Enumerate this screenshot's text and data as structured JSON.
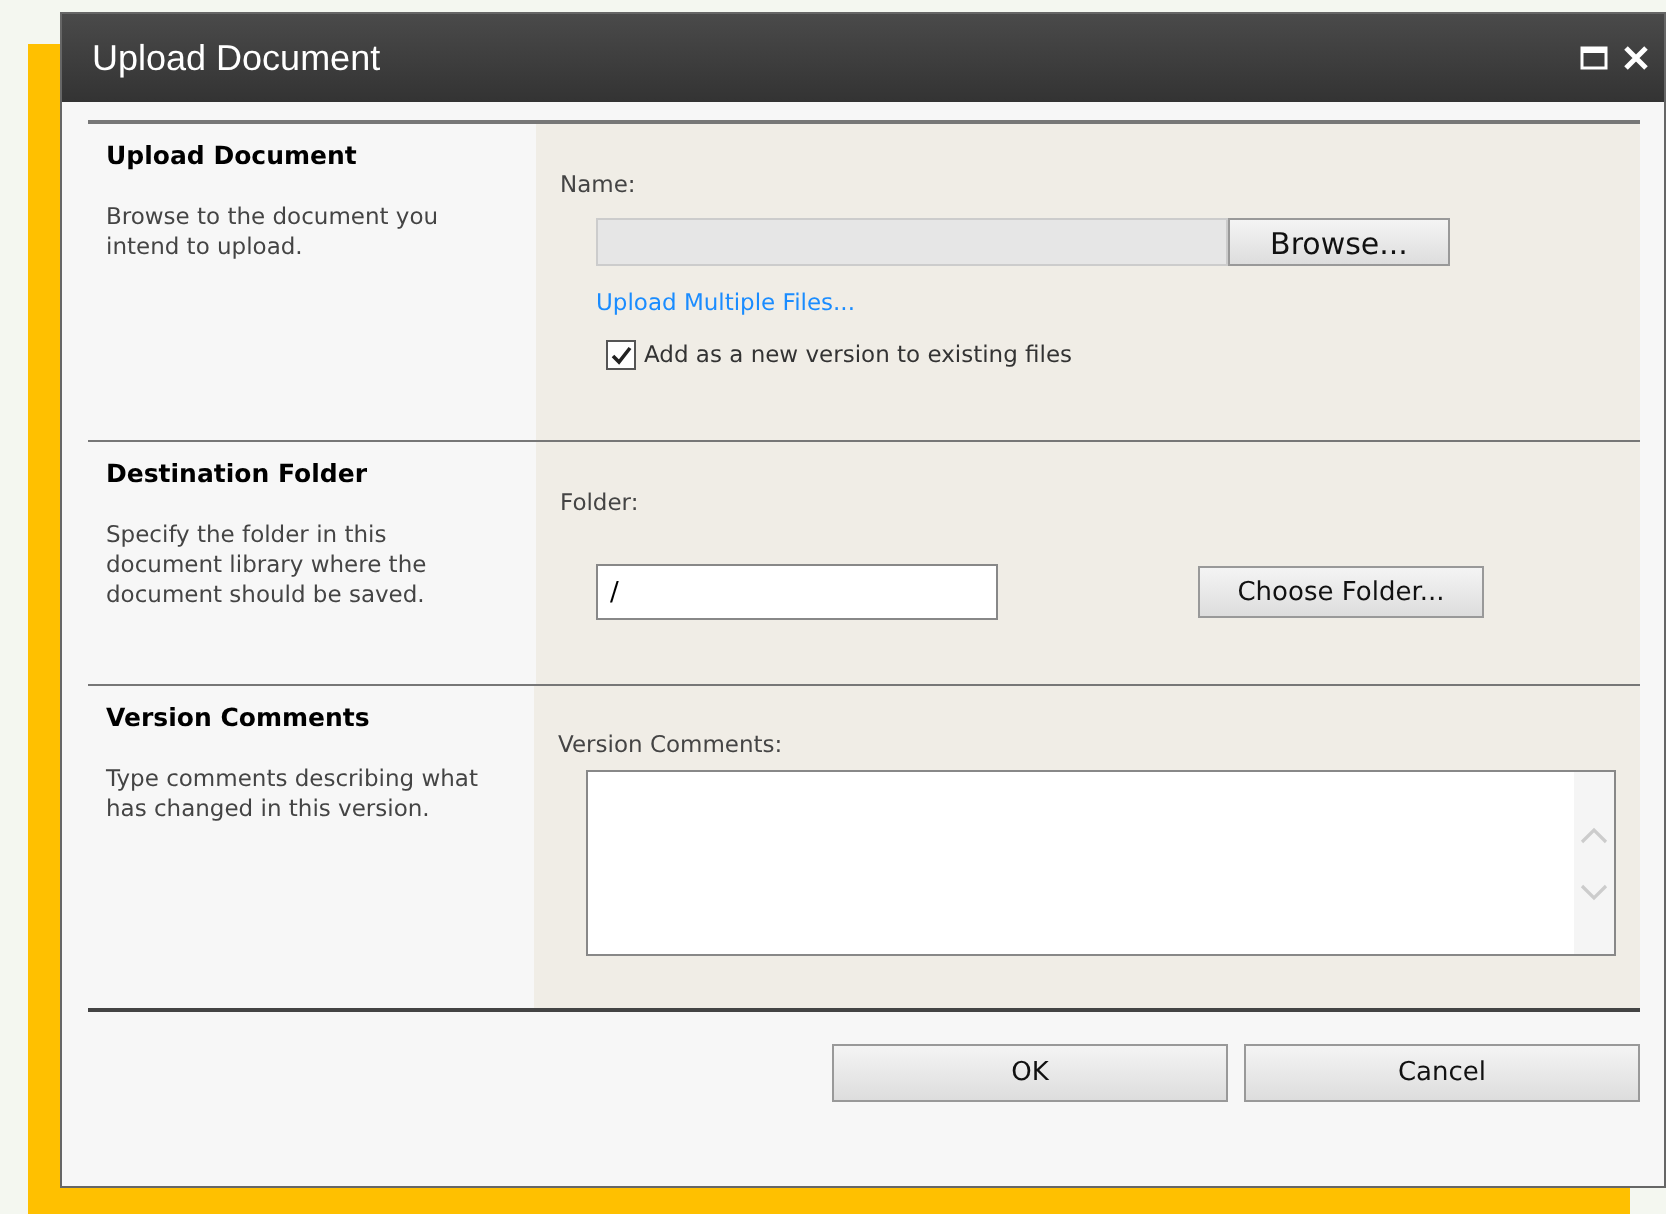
{
  "window": {
    "title": "Upload Document"
  },
  "sections": [
    {
      "kind": "file",
      "title": "Upload Document",
      "description": "Browse to the document you intend to upload.",
      "field_label": "Name:",
      "button": "Browse...",
      "link": "Upload Multiple Files...",
      "checkbox": {
        "label": "Add as a new version to existing files",
        "checked": true
      }
    },
    {
      "kind": "folder",
      "title": "Destination Folder",
      "description": "Specify the folder in this document library where the document should be saved.",
      "field_label": "Folder:",
      "value": "/",
      "button": "Choose Folder..."
    },
    {
      "kind": "comments",
      "title": "Version Comments",
      "description": "Type comments describing what has changed in this version.",
      "field_label": "Version Comments:"
    }
  ],
  "buttons": [
    "OK",
    "Cancel"
  ]
}
